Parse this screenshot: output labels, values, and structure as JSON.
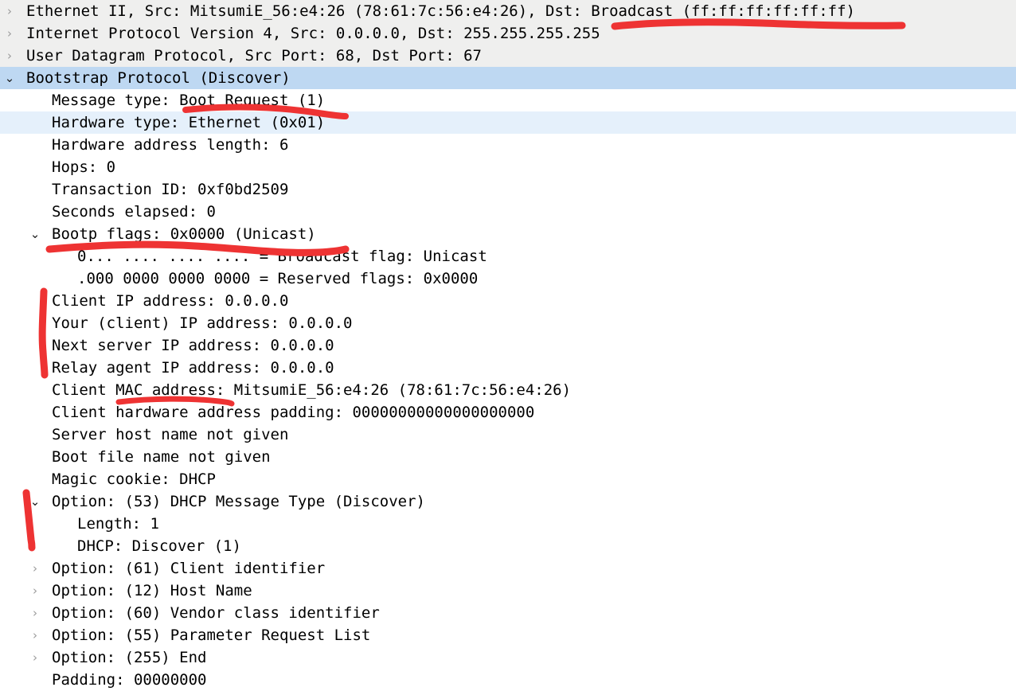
{
  "app": {
    "pane": "packet-details",
    "protocol": "DHCP / BOOTP Discover"
  },
  "colors": {
    "selected_row_bg": "#bed8f2",
    "alt_row_bg": "#e5f0fb",
    "gray_row_bg": "#efefee",
    "annotation_red": "#ee3333",
    "text": "#000000",
    "twisty_collapsed": "#9b9b9b"
  },
  "icons": {
    "collapsed": "›",
    "expanded": "⌄"
  },
  "rows": [
    {
      "text": "Ethernet II, Src: MitsumiE_56:e4:26 (78:61:7c:56:e4:26), Dst: Broadcast (ff:ff:ff:ff:ff:ff)",
      "indent": 0,
      "twisty": "collapsed",
      "bg": "gray"
    },
    {
      "text": "Internet Protocol Version 4, Src: 0.0.0.0, Dst: 255.255.255.255",
      "indent": 0,
      "twisty": "collapsed",
      "bg": "gray"
    },
    {
      "text": "User Datagram Protocol, Src Port: 68, Dst Port: 67",
      "indent": 0,
      "twisty": "collapsed",
      "bg": "gray"
    },
    {
      "text": "Bootstrap Protocol (Discover)",
      "indent": 0,
      "twisty": "expanded",
      "bg": "sel"
    },
    {
      "text": "Message type: Boot Request (1)",
      "indent": 1,
      "twisty": "none",
      "bg": "white"
    },
    {
      "text": "Hardware type: Ethernet (0x01)",
      "indent": 1,
      "twisty": "none",
      "bg": "alt"
    },
    {
      "text": "Hardware address length: 6",
      "indent": 1,
      "twisty": "none",
      "bg": "white"
    },
    {
      "text": "Hops: 0",
      "indent": 1,
      "twisty": "none",
      "bg": "white"
    },
    {
      "text": "Transaction ID: 0xf0bd2509",
      "indent": 1,
      "twisty": "none",
      "bg": "white"
    },
    {
      "text": "Seconds elapsed: 0",
      "indent": 1,
      "twisty": "none",
      "bg": "white"
    },
    {
      "text": "Bootp flags: 0x0000 (Unicast)",
      "indent": 1,
      "twisty": "expanded",
      "bg": "white"
    },
    {
      "text": "0... .... .... .... = Broadcast flag: Unicast",
      "indent": 2,
      "twisty": "none",
      "bg": "white"
    },
    {
      "text": ".000 0000 0000 0000 = Reserved flags: 0x0000",
      "indent": 2,
      "twisty": "none",
      "bg": "white"
    },
    {
      "text": "Client IP address: 0.0.0.0",
      "indent": 1,
      "twisty": "none",
      "bg": "white"
    },
    {
      "text": "Your (client) IP address: 0.0.0.0",
      "indent": 1,
      "twisty": "none",
      "bg": "white"
    },
    {
      "text": "Next server IP address: 0.0.0.0",
      "indent": 1,
      "twisty": "none",
      "bg": "white"
    },
    {
      "text": "Relay agent IP address: 0.0.0.0",
      "indent": 1,
      "twisty": "none",
      "bg": "white"
    },
    {
      "text": "Client MAC address: MitsumiE_56:e4:26 (78:61:7c:56:e4:26)",
      "indent": 1,
      "twisty": "none",
      "bg": "white"
    },
    {
      "text": "Client hardware address padding: 00000000000000000000",
      "indent": 1,
      "twisty": "none",
      "bg": "white"
    },
    {
      "text": "Server host name not given",
      "indent": 1,
      "twisty": "none",
      "bg": "white"
    },
    {
      "text": "Boot file name not given",
      "indent": 1,
      "twisty": "none",
      "bg": "white"
    },
    {
      "text": "Magic cookie: DHCP",
      "indent": 1,
      "twisty": "none",
      "bg": "white"
    },
    {
      "text": "Option: (53) DHCP Message Type (Discover)",
      "indent": 1,
      "twisty": "expanded",
      "bg": "white"
    },
    {
      "text": "Length: 1",
      "indent": 2,
      "twisty": "none",
      "bg": "white"
    },
    {
      "text": "DHCP: Discover (1)",
      "indent": 2,
      "twisty": "none",
      "bg": "white"
    },
    {
      "text": "Option: (61) Client identifier",
      "indent": 1,
      "twisty": "collapsed",
      "bg": "white"
    },
    {
      "text": "Option: (12) Host Name",
      "indent": 1,
      "twisty": "collapsed",
      "bg": "white"
    },
    {
      "text": "Option: (60) Vendor class identifier",
      "indent": 1,
      "twisty": "collapsed",
      "bg": "white"
    },
    {
      "text": "Option: (55) Parameter Request List",
      "indent": 1,
      "twisty": "collapsed",
      "bg": "white"
    },
    {
      "text": "Option: (255) End",
      "indent": 1,
      "twisty": "collapsed",
      "bg": "white"
    },
    {
      "text": "Padding: 00000000",
      "indent": 1,
      "twisty": "none",
      "bg": "white"
    }
  ],
  "annotations": [
    {
      "name": "underline-broadcast-dst",
      "kind": "underline",
      "target": "Dst: Broadcast (ff:ff:ff:ff:ff:ff)"
    },
    {
      "name": "underline-boot-request",
      "kind": "underline",
      "target": "Boot Request (1)"
    },
    {
      "name": "underline-bootp-flags-value",
      "kind": "underline",
      "target": "Bootp flags: 0x0000 (Unicast)"
    },
    {
      "name": "bracket-ip-address-block",
      "kind": "vertical-bar",
      "target": "Client/Your/Next server/Relay agent IP address rows"
    },
    {
      "name": "underline-mac-address-label",
      "kind": "underline",
      "target": "MAC address:"
    },
    {
      "name": "slash-dhcp-message-type-option",
      "kind": "diagonal-bar",
      "target": "Option: (53) DHCP Message Type (Discover)"
    }
  ]
}
